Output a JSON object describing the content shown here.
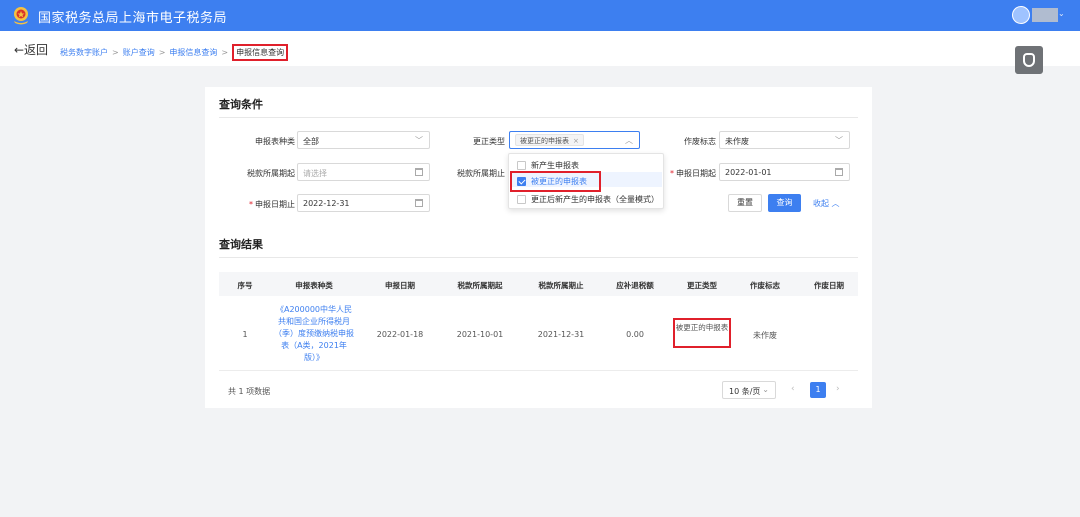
{
  "header": {
    "title": "国家税务总局上海市电子税务局",
    "brand_color": "#3d7ff0",
    "user_icon": "user-avatar-icon",
    "menu_icon": "chevron-down-icon"
  },
  "nav": {
    "back_label": "←返回",
    "breadcrumbs": [
      "税务数字账户",
      "账户查询",
      "申报信息查询",
      "申报信息查询"
    ],
    "separator": ">"
  },
  "query": {
    "title": "查询条件",
    "fields": {
      "report_type": {
        "label": "申报表种类",
        "value": "全部"
      },
      "correction_type": {
        "label": "更正类型",
        "tag": "被更正的申报表",
        "tag_close": "×"
      },
      "void_flag": {
        "label": "作废标志",
        "value": "未作废"
      },
      "period_start": {
        "label": "税款所属期起",
        "placeholder": "请选择"
      },
      "period_end": {
        "label": "税款所属期止"
      },
      "report_date_start": {
        "label": "申报日期起",
        "value": "2022-01-01"
      },
      "report_date_end": {
        "label": "申报日期止",
        "value": "2022-12-31"
      }
    },
    "dropdown_options": [
      {
        "label": "新产生申报表",
        "checked": false
      },
      {
        "label": "被更正的申报表",
        "checked": true
      },
      {
        "label": "更正后新产生的申报表（全量模式）",
        "checked": false
      }
    ],
    "reset_label": "重置",
    "search_label": "查询",
    "collapse_label": "收起 ︿"
  },
  "results": {
    "title": "查询结果",
    "columns": [
      "序号",
      "申报表种类",
      "申报日期",
      "税款所属期起",
      "税款所属期止",
      "应补退税额",
      "更正类型",
      "作废标志",
      "作废日期"
    ],
    "rows": [
      {
        "index": "1",
        "report_type": "《A200000中华人民共和国企业所得税月（季）度预缴纳税申报表（A类，2021年版）》",
        "report_date": "2022-01-18",
        "period_start": "2021-10-01",
        "period_end": "2021-12-31",
        "tax_amount": "0.00",
        "correction_type": "被更正的申报表",
        "void_flag": "未作废",
        "void_date": ""
      }
    ],
    "total": "共 1 项数据",
    "page_size": "10 条/页",
    "current_page": "1",
    "prev": "‹",
    "next": "›"
  }
}
